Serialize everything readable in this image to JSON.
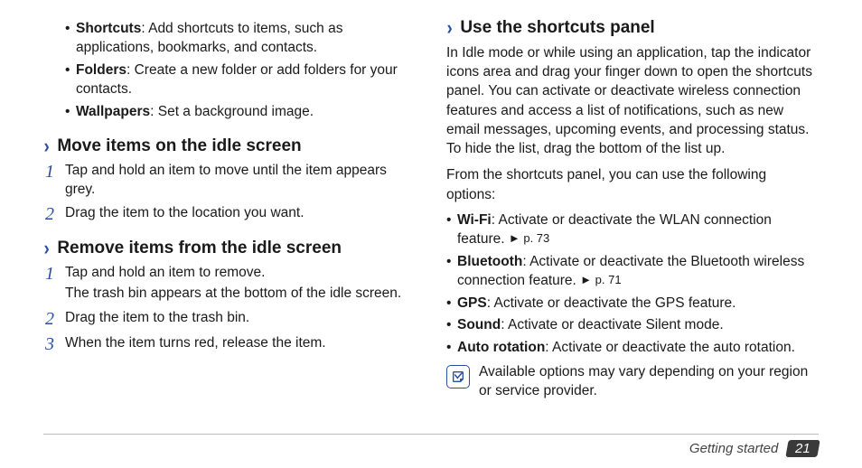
{
  "left": {
    "bullets": [
      {
        "term": "Shortcuts",
        "desc": ": Add shortcuts to items, such as applications, bookmarks, and contacts."
      },
      {
        "term": "Folders",
        "desc": ": Create a new folder or add folders for your contacts."
      },
      {
        "term": "Wallpapers",
        "desc": ": Set a background image."
      }
    ],
    "section1": {
      "title": "Move items on the idle screen",
      "steps": [
        {
          "n": "1",
          "text": "Tap and hold an item to move until the item appears grey."
        },
        {
          "n": "2",
          "text": "Drag the item to the location you want."
        }
      ]
    },
    "section2": {
      "title": "Remove items from the idle screen",
      "steps": [
        {
          "n": "1",
          "text": "Tap and hold an item to remove.",
          "sub": "The trash bin appears at the bottom of the idle screen."
        },
        {
          "n": "2",
          "text": "Drag the item to the trash bin."
        },
        {
          "n": "3",
          "text": "When the item turns red, release the item."
        }
      ]
    }
  },
  "right": {
    "section": {
      "title": "Use the shortcuts panel",
      "para1": "In Idle mode or while using an application, tap the indicator icons area and drag your finger down to open the shortcuts panel. You can activate or deactivate wireless connection features and access a list of notifications, such as new email messages, upcoming events, and processing status. To hide the list, drag the bottom of the list up.",
      "para2": "From the shortcuts panel, you can use the following options:",
      "options": [
        {
          "term": "Wi-Fi",
          "desc": ": Activate or deactivate the WLAN connection feature. ",
          "ref": "► p. 73"
        },
        {
          "term": "Bluetooth",
          "desc": ": Activate or deactivate the Bluetooth wireless connection feature. ",
          "ref": "► p. 71"
        },
        {
          "term": "GPS",
          "desc": ": Activate or deactivate the GPS feature.",
          "ref": ""
        },
        {
          "term": "Sound",
          "desc": ": Activate or deactivate Silent mode.",
          "ref": ""
        },
        {
          "term": "Auto rotation",
          "desc": ": Activate or deactivate the auto rotation.",
          "ref": ""
        }
      ],
      "note": "Available options may vary depending on your region or service provider."
    }
  },
  "footer": {
    "section": "Getting started",
    "page": "21"
  }
}
